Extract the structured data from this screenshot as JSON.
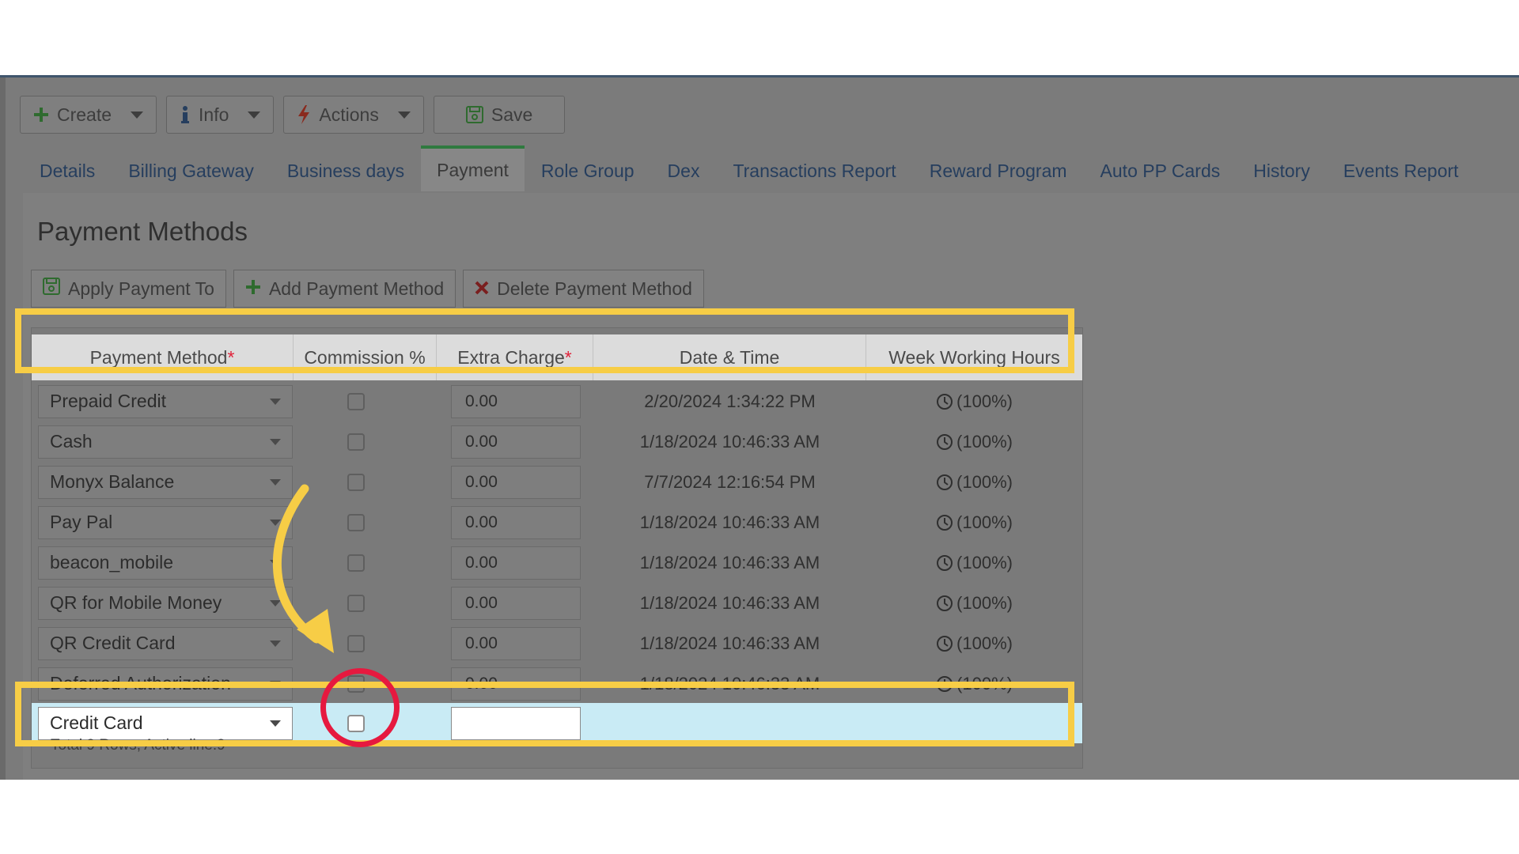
{
  "toolbar": {
    "create": "Create",
    "info": "Info",
    "actions": "Actions",
    "save": "Save"
  },
  "tabs": [
    "Details",
    "Billing Gateway",
    "Business days",
    "Payment",
    "Role Group",
    "Dex",
    "Transactions Report",
    "Reward Program",
    "Auto PP Cards",
    "History",
    "Events Report"
  ],
  "active_tab": "Payment",
  "section_title": "Payment Methods",
  "action_buttons": {
    "apply": "Apply Payment To",
    "add": "Add Payment Method",
    "delete": "Delete Payment Method"
  },
  "grid": {
    "headers": {
      "method": "Payment Method",
      "commission": "Commission %",
      "extra": "Extra Charge",
      "datetime": "Date & Time",
      "hours": "Week Working Hours"
    },
    "required_mark": "*",
    "rows": [
      {
        "method": "Prepaid Credit",
        "extra": "0.00",
        "datetime": "2/20/2024 1:34:22 PM",
        "hours": "(100%)"
      },
      {
        "method": "Cash",
        "extra": "0.00",
        "datetime": "1/18/2024 10:46:33 AM",
        "hours": "(100%)"
      },
      {
        "method": "Monyx Balance",
        "extra": "0.00",
        "datetime": "7/7/2024 12:16:54 PM",
        "hours": "(100%)"
      },
      {
        "method": "Pay Pal",
        "extra": "0.00",
        "datetime": "1/18/2024 10:46:33 AM",
        "hours": "(100%)"
      },
      {
        "method": "beacon_mobile",
        "extra": "0.00",
        "datetime": "1/18/2024 10:46:33 AM",
        "hours": "(100%)"
      },
      {
        "method": "QR for Mobile Money",
        "extra": "0.00",
        "datetime": "1/18/2024 10:46:33 AM",
        "hours": "(100%)"
      },
      {
        "method": "QR Credit Card",
        "extra": "0.00",
        "datetime": "1/18/2024 10:46:33 AM",
        "hours": "(100%)"
      },
      {
        "method": "Deferred Authorization",
        "extra": "0.00",
        "datetime": "1/18/2024 10:46:33 AM",
        "hours": "(100%)"
      },
      {
        "method": "Credit Card",
        "extra": "",
        "datetime": "",
        "hours": ""
      }
    ],
    "footer": "Total 9 Rows, Active line:9"
  },
  "colors": {
    "highlight": "#f7cd46",
    "ring": "#e6193f",
    "active_row": "#c9ebf5",
    "tab_active_border": "#2f7a3f"
  }
}
